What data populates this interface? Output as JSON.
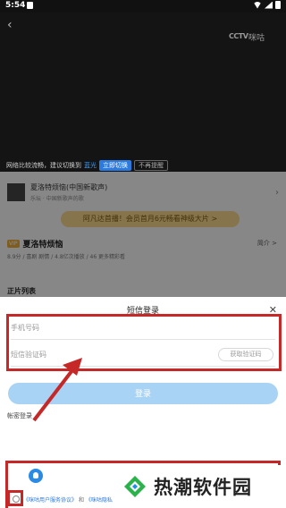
{
  "status_bar": {
    "time": "5:54"
  },
  "video": {
    "logo_cctv": "CCTV",
    "logo_brand": "咪咕",
    "notice": {
      "text_before": "网络比较流畅，建议切换到",
      "highlight": "蓝光",
      "switch_label": "立即切换",
      "later_label": "不再提醒"
    }
  },
  "content": {
    "song_title": "夏洛特烦恼(中国新歌声)",
    "song_subtitle": "乐坛 · 中国新歌声的歌",
    "vip_banner": "阿凡达首播！会员首月6元畅看神级大片 >",
    "vip_tag": "VIP",
    "show_title": "夏洛特烦恼",
    "show_intro": "简介 >",
    "show_meta": "8.9分 / 喜剧 剧情 / 4.8亿次播放 / 46 更多精彩看",
    "episodes_title": "正片列表"
  },
  "login": {
    "title": "短信登录",
    "phone_placeholder": "手机号码",
    "code_placeholder": "短信验证码",
    "get_code_label": "获取验证码",
    "login_label": "登录",
    "password_login_label": "帐密登录",
    "agreement": {
      "link1": "《咪咕用户服务协议》",
      "and": "和",
      "link2": "《咪咕隐私"
    }
  },
  "watermark": {
    "text": "热潮软件园"
  },
  "colors": {
    "annotation_red": "#c62828",
    "login_button": "#a9d3f5",
    "link_blue": "#2a7ae0"
  }
}
